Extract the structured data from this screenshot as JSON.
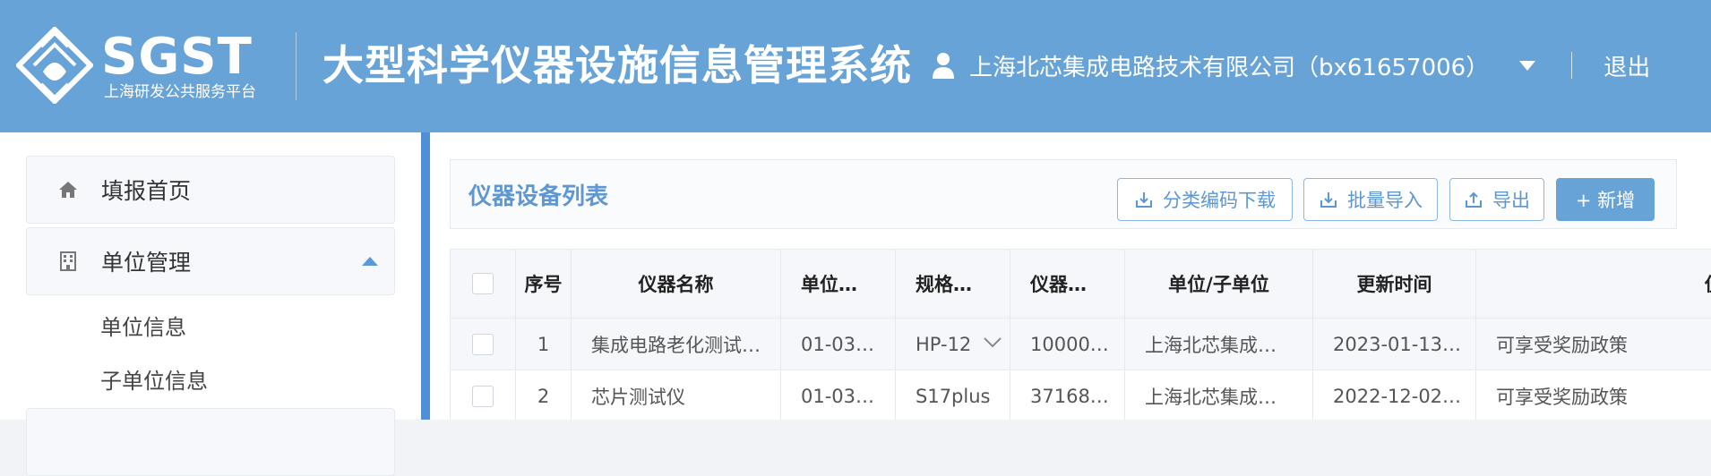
{
  "header": {
    "logo_text": "SGST",
    "logo_subtitle": "上海研发公共服务平台",
    "system_title": "大型科学仪器设施信息管理系统",
    "user_label": "上海北芯集成电路技术有限公司（bx61657006）",
    "logout_label": "退出"
  },
  "sidebar": {
    "items": [
      {
        "label": "填报首页",
        "icon": "home-icon"
      },
      {
        "label": "单位管理",
        "icon": "building-icon",
        "expanded": true,
        "children": [
          {
            "label": "单位信息"
          },
          {
            "label": "子单位信息"
          }
        ]
      }
    ]
  },
  "main": {
    "list_title": "仪器设备列表",
    "buttons": {
      "download_codes": "分类编码下载",
      "batch_import": "批量导入",
      "export": "导出",
      "add": "+ 新增"
    },
    "table": {
      "columns": [
        "序号",
        "仪器名称",
        "单位…",
        "规格…",
        "仪器…",
        "单位/子单位",
        "更新时间",
        "仪器"
      ],
      "rows": [
        {
          "no": "1",
          "name": "集成电路老化测试…",
          "unit_code": "01-03…",
          "spec": "HP-12",
          "inst": "10000…",
          "org": "上海北芯集成…",
          "updated": "2023-01-13…",
          "policy": "可享受奖励政策"
        },
        {
          "no": "2",
          "name": "芯片测试仪",
          "unit_code": "01-03…",
          "spec": "S17plus",
          "inst": "37168…",
          "org": "上海北芯集成…",
          "updated": "2022-12-02…",
          "policy": "可享受奖励政策"
        }
      ]
    }
  },
  "colors": {
    "header_bg": "#68a3d8",
    "accent": "#5e97d2",
    "primary_button": "#68a3d8"
  }
}
